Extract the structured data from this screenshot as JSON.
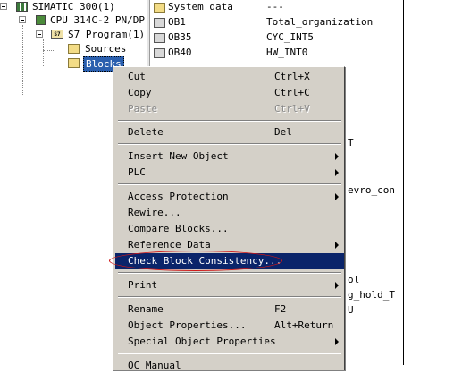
{
  "tree": {
    "items": [
      {
        "label": "SIMATIC 300(1)",
        "icon": "station-icon"
      },
      {
        "label": "CPU 314C-2 PN/DP",
        "icon": "cpu-icon"
      },
      {
        "label": "S7 Program(1)",
        "icon": "s7-program-icon",
        "icon_text": "S7"
      },
      {
        "label": "Sources",
        "icon": "folder-icon"
      },
      {
        "label": "Blocks",
        "icon": "blocks-folder-icon",
        "selected": true
      }
    ]
  },
  "blocks_list": {
    "rows": [
      {
        "name": "System data",
        "value": "---"
      },
      {
        "name": "OB1",
        "value": "Total_organization"
      },
      {
        "name": "OB35",
        "value": "CYC_INT5"
      },
      {
        "name": "OB40",
        "value": "HW_INT0"
      }
    ],
    "partial_text": [
      "T",
      "evro_con",
      "ol",
      "g_hold_T",
      "U"
    ]
  },
  "context_menu": {
    "items": [
      {
        "label": "Cut",
        "shortcut": "Ctrl+X"
      },
      {
        "label": "Copy",
        "shortcut": "Ctrl+C"
      },
      {
        "label": "Paste",
        "shortcut": "Ctrl+V",
        "disabled": true
      },
      {
        "label": "Delete",
        "shortcut": "Del"
      },
      {
        "label": "Insert New Object",
        "submenu": true
      },
      {
        "label": "PLC",
        "submenu": true
      },
      {
        "label": "Access Protection",
        "submenu": true
      },
      {
        "label": "Rewire..."
      },
      {
        "label": "Compare Blocks..."
      },
      {
        "label": "Reference Data",
        "submenu": true
      },
      {
        "label": "Check Block Consistency...",
        "highlighted": true
      },
      {
        "label": "Print",
        "submenu": true
      },
      {
        "label": "Rename",
        "shortcut": "F2"
      },
      {
        "label": "Object Properties...",
        "shortcut": "Alt+Return"
      },
      {
        "label": "Special Object Properties",
        "submenu": true
      },
      {
        "label": "OC Manual"
      }
    ],
    "highlight_color": "#0a246a",
    "annotation_color": "#d01818"
  }
}
